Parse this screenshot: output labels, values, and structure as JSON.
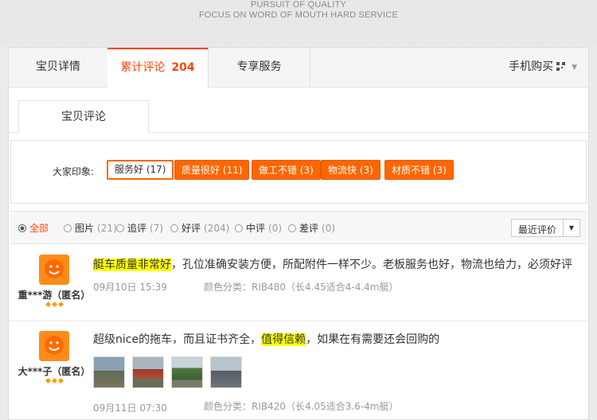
{
  "banner": {
    "line1": "PURSUIT OF QUALITY",
    "line2": "FOCUS ON WORD OF MOUTH  HARD SERVICE"
  },
  "tabs": [
    {
      "label": "宝贝详情"
    },
    {
      "label": "累计评论",
      "count": "204"
    },
    {
      "label": "专享服务"
    }
  ],
  "mobile_buy": "手机购买",
  "subtab": "宝贝评论",
  "impressions": {
    "label": "大家印象:",
    "tags": [
      "服务好 (17)",
      "质量很好 (11)",
      "做工不错 (3)",
      "物流快 (3)",
      "材质不错 (3)"
    ]
  },
  "filters": [
    {
      "label": "全部",
      "count": ""
    },
    {
      "label": "图片",
      "count": "(21)"
    },
    {
      "label": "追评",
      "count": "(7)"
    },
    {
      "label": "好评",
      "count": "(204)"
    },
    {
      "label": "中评",
      "count": "(0)"
    },
    {
      "label": "差评",
      "count": "(0)"
    }
  ],
  "sort": {
    "label": "最近评价"
  },
  "reviews": [
    {
      "user": "重***游（匿名）",
      "stars": "◆◆◆",
      "highlight": "艇车质量非常好",
      "text_rest": "，孔位准确安装方便，所配附件一样不少。老板服务也好，物流也给力，必须好评",
      "date": "09月10日 15:39",
      "spec": "颜色分类：RIB480（长4.45适合4-4.4m艇）"
    },
    {
      "user": "大***子（匿名）",
      "stars": "◆◆◆",
      "text_before": "超级nice的拖车，而且证书齐全，",
      "highlight": "值得信赖",
      "text_after": "，如果在有需要还会回购的",
      "photos": 4,
      "date": "09月11日 07:30",
      "spec": "颜色分类：RIB420（长4.05适合3.6-4m艇）"
    }
  ],
  "colors": {
    "accent": "#ff4400",
    "tag_bg": "#ff6600",
    "highlight": "#ffff00"
  }
}
